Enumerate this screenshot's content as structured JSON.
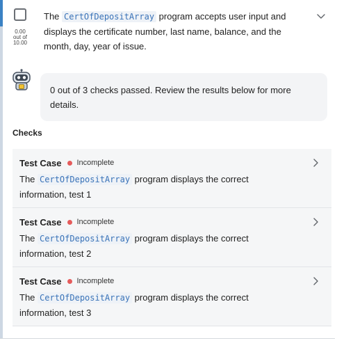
{
  "task": {
    "score_value": "0.00",
    "score_out_of": "out of",
    "score_max": "10.00",
    "text_before": "The ",
    "code_name": "CertOfDepositArray",
    "text_after": " program accepts user input and displays the certificate number, last name, balance, and the month, day, year of issue."
  },
  "feedback": {
    "message": "0 out of 3 checks passed. Review the results below for more details."
  },
  "checks": {
    "heading": "Checks",
    "items": [
      {
        "title": "Test Case",
        "status": "Incomplete",
        "desc_before": "The ",
        "code": "CertOfDepositArray",
        "desc_after": " program displays the correct information, test 1"
      },
      {
        "title": "Test Case",
        "status": "Incomplete",
        "desc_before": "The ",
        "code": "CertOfDepositArray",
        "desc_after": " program displays the correct information, test 2"
      },
      {
        "title": "Test Case",
        "status": "Incomplete",
        "desc_before": "The ",
        "code": "CertOfDepositArray",
        "desc_after": " program displays the correct information, test 3"
      }
    ]
  },
  "colors": {
    "accent": "#3b82c4",
    "code_text": "#3a73b8",
    "status_incomplete": "#e55b5b"
  },
  "icons": {
    "expand": "chevron-down-icon",
    "case_expand": "chevron-right-icon",
    "bot": "robot-avatar-icon"
  }
}
